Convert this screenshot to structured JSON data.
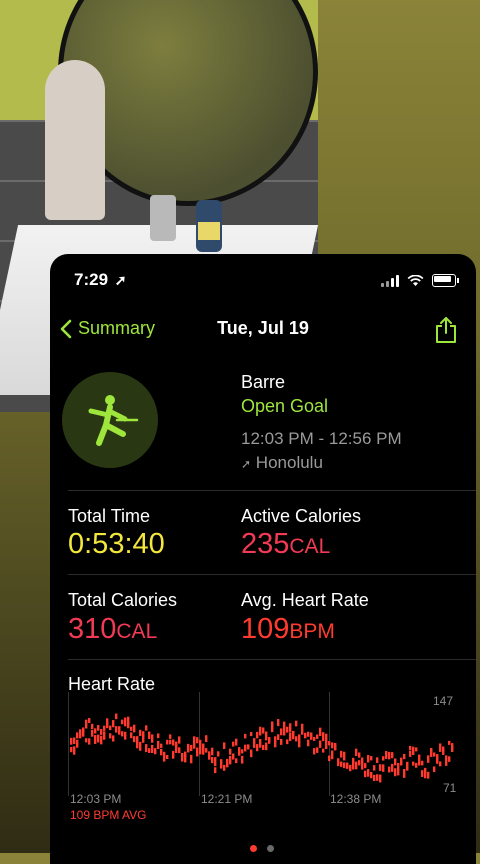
{
  "status_bar": {
    "time": "7:29"
  },
  "nav": {
    "back_label": "Summary",
    "title": "Tue, Jul 19"
  },
  "workout": {
    "name": "Barre",
    "goal": "Open Goal",
    "time_range": "12:03 PM - 12:56 PM",
    "location": "Honolulu"
  },
  "stats": {
    "total_time": {
      "label": "Total Time",
      "value": "0:53:40"
    },
    "active_calories": {
      "label": "Active Calories",
      "value": "235",
      "unit": "CAL"
    },
    "total_calories": {
      "label": "Total Calories",
      "value": "310",
      "unit": "CAL"
    },
    "avg_heart_rate": {
      "label": "Avg. Heart Rate",
      "value": "109",
      "unit": "BPM"
    }
  },
  "heart_rate": {
    "title": "Heart Rate",
    "max_label": "147",
    "min_label": "71",
    "time_labels": [
      "12:03 PM",
      "12:21 PM",
      "12:38 PM"
    ],
    "avg_label": "109 BPM AVG"
  },
  "colors": {
    "accent_green": "#9ee63c",
    "yellow": "#f3e63c",
    "red": "#f23a54",
    "heart_orange": "#ff3b2f"
  },
  "page_indicator": {
    "count": 2,
    "active": 0
  }
}
